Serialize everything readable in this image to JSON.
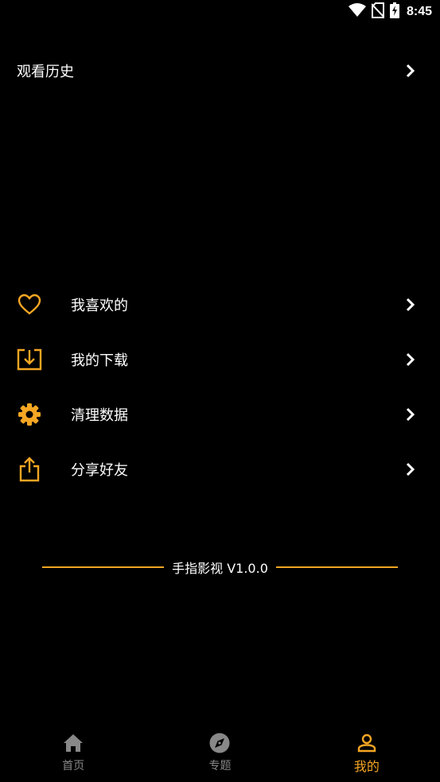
{
  "status_bar": {
    "time": "8:45",
    "icons": [
      "wifi-icon",
      "no-sim-icon",
      "battery-charging-icon"
    ]
  },
  "history": {
    "label": "观看历史"
  },
  "menu": [
    {
      "label": "我喜欢的",
      "icon": "heart-icon"
    },
    {
      "label": "我的下载",
      "icon": "download-icon"
    },
    {
      "label": "清理数据",
      "icon": "gear-icon"
    },
    {
      "label": "分享好友",
      "icon": "share-icon"
    }
  ],
  "version": {
    "text": "手指影视 V1.0.0"
  },
  "bottom_nav": [
    {
      "label": "首页",
      "icon": "home-icon",
      "active": false
    },
    {
      "label": "专题",
      "icon": "compass-icon",
      "active": false
    },
    {
      "label": "我的",
      "icon": "person-icon",
      "active": true
    }
  ],
  "colors": {
    "accent": "#f5a623",
    "background": "#000000",
    "inactive": "#888888"
  }
}
